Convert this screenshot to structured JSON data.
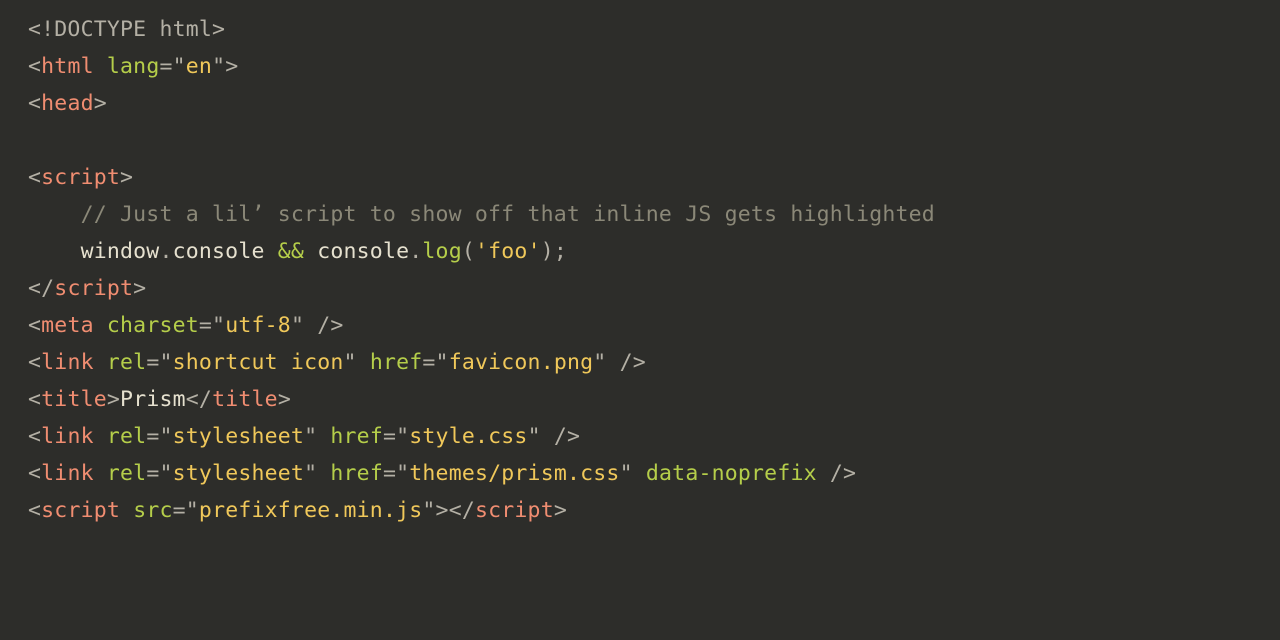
{
  "code": {
    "doctype": "<!DOCTYPE html>",
    "html_open_bracket": "<",
    "html_tag": "html",
    "html_lang_attr": "lang",
    "html_lang_eq": "=\"",
    "html_lang_val": "en",
    "html_lang_close": "\"",
    "html_close_bracket": ">",
    "head_open_bracket": "<",
    "head_tag": "head",
    "head_close_bracket": ">",
    "script_open_bracket": "<",
    "script_tag": "script",
    "script_close_bracket": ">",
    "js_comment": "    // Just a lil’ script to show off that inline JS gets highlighted",
    "js_indent": "    ",
    "js_window": "window",
    "js_dot1": ".",
    "js_console1": "console",
    "js_sp1": " ",
    "js_andand": "&&",
    "js_sp2": " ",
    "js_console2": "console",
    "js_dot2": ".",
    "js_log": "log",
    "js_lp": "(",
    "js_foo": "'foo'",
    "js_rp": ")",
    "js_semi": ";",
    "script_end_open": "</",
    "script_end_tag": "script",
    "script_end_close": ">",
    "meta_open": "<",
    "meta_tag": "meta",
    "meta_sp": " ",
    "meta_attr": "charset",
    "meta_eq": "=\"",
    "meta_val": "utf-8",
    "meta_q": "\"",
    "meta_close": " />",
    "link1_open": "<",
    "link1_tag": "link",
    "link1_sp1": " ",
    "link1_rel_attr": "rel",
    "link1_rel_eq": "=\"",
    "link1_rel_val": "shortcut icon",
    "link1_rel_q": "\"",
    "link1_sp2": " ",
    "link1_href_attr": "href",
    "link1_href_eq": "=\"",
    "link1_href_val": "favicon.png",
    "link1_href_q": "\"",
    "link1_close": " />",
    "title_open": "<",
    "title_tag": "title",
    "title_gt": ">",
    "title_text": "Prism",
    "title_end_open": "</",
    "title_end_tag": "title",
    "title_end_close": ">",
    "link2_open": "<",
    "link2_tag": "link",
    "link2_sp1": " ",
    "link2_rel_attr": "rel",
    "link2_rel_eq": "=\"",
    "link2_rel_val": "stylesheet",
    "link2_rel_q": "\"",
    "link2_sp2": " ",
    "link2_href_attr": "href",
    "link2_href_eq": "=\"",
    "link2_href_val": "style.css",
    "link2_href_q": "\"",
    "link2_close": " />",
    "link3_open": "<",
    "link3_tag": "link",
    "link3_sp1": " ",
    "link3_rel_attr": "rel",
    "link3_rel_eq": "=\"",
    "link3_rel_val": "stylesheet",
    "link3_rel_q": "\"",
    "link3_sp2": " ",
    "link3_href_attr": "href",
    "link3_href_eq": "=\"",
    "link3_href_val": "themes/prism.css",
    "link3_href_q": "\"",
    "link3_sp3": " ",
    "link3_noprefix": "data-noprefix",
    "link3_close": " />",
    "script2_open": "<",
    "script2_tag": "script",
    "script2_sp": " ",
    "script2_src_attr": "src",
    "script2_src_eq": "=\"",
    "script2_src_val": "prefixfree.min.js",
    "script2_src_q": "\"",
    "script2_gt": ">",
    "script2_end_open": "</",
    "script2_end_tag": "script",
    "script2_end_close": ">"
  }
}
